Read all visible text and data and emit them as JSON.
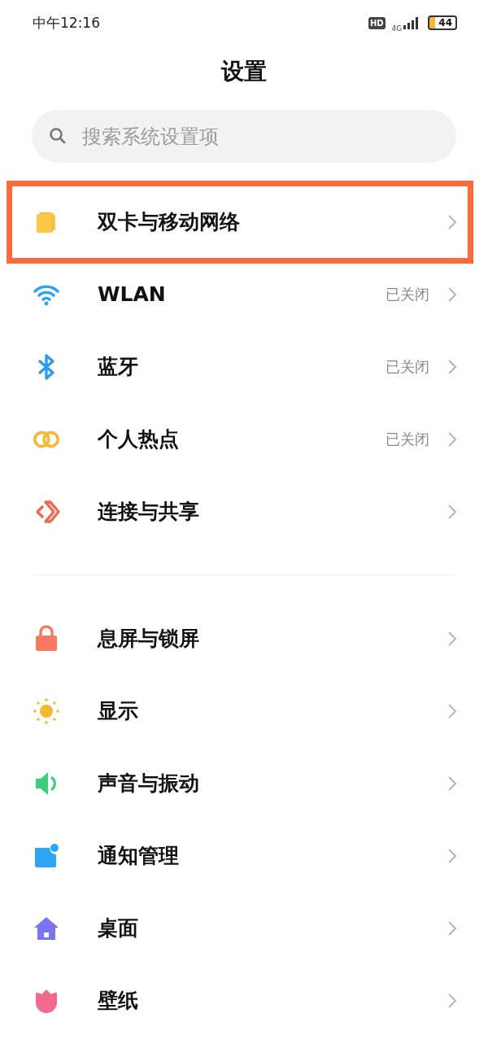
{
  "status_bar": {
    "time": "中午12:16",
    "hd_badge": "HD",
    "network": "4G",
    "battery": "44"
  },
  "title": "设置",
  "search": {
    "placeholder": "搜索系统设置项"
  },
  "sections": [
    {
      "items": [
        {
          "kind": "sim",
          "label": "双卡与移动网络",
          "highlighted": true
        },
        {
          "kind": "wifi",
          "label": "WLAN",
          "value": "已关闭",
          "highlighted": false
        },
        {
          "kind": "bluetooth",
          "label": "蓝牙",
          "value": "已关闭",
          "highlighted": false
        },
        {
          "kind": "hotspot",
          "label": "个人热点",
          "value": "已关闭",
          "highlighted": false
        },
        {
          "kind": "share",
          "label": "连接与共享",
          "highlighted": false
        }
      ]
    },
    {
      "items": [
        {
          "kind": "lock",
          "label": "息屏与锁屏",
          "highlighted": false
        },
        {
          "kind": "sun",
          "label": "显示",
          "highlighted": false
        },
        {
          "kind": "sound",
          "label": "声音与振动",
          "highlighted": false
        },
        {
          "kind": "notify",
          "label": "通知管理",
          "highlighted": false
        },
        {
          "kind": "home",
          "label": "桌面",
          "highlighted": false
        },
        {
          "kind": "flower",
          "label": "壁纸",
          "highlighted": false
        }
      ]
    }
  ]
}
